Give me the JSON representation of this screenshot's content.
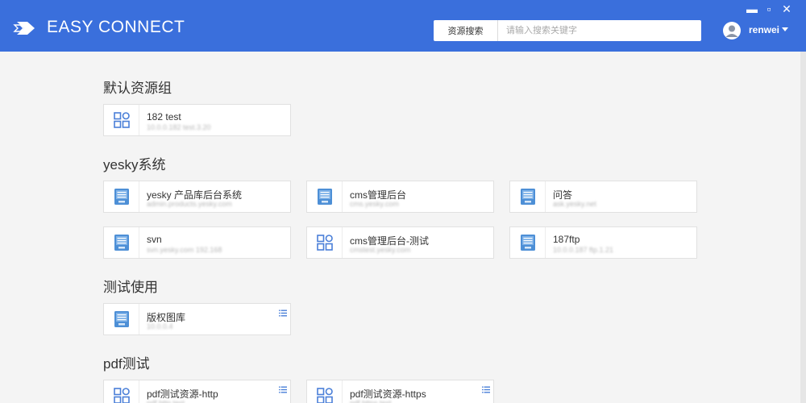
{
  "app": {
    "brand": "EASY CONNECT"
  },
  "search": {
    "button": "资源搜索",
    "placeholder": "请输入搜索关键字"
  },
  "user": {
    "name": "renwei"
  },
  "window": {
    "minimize": "▬",
    "maximize": "▫",
    "close": "✕"
  },
  "groups": [
    {
      "title": "默认资源组",
      "items": [
        {
          "name": "182 test",
          "sub": "10.0.0.182 test.3.20",
          "icon": "apps-grid-icon",
          "menu": false
        }
      ]
    },
    {
      "title": "yesky系统",
      "items": [
        {
          "name": "yesky 产品库后台系统",
          "sub": "admin.products.yesky.com",
          "icon": "document-icon",
          "menu": false
        },
        {
          "name": "cms管理后台",
          "sub": "cms.yesky.com",
          "icon": "document-icon",
          "menu": false
        },
        {
          "name": "问答",
          "sub": "ask.yesky.net",
          "icon": "document-icon",
          "menu": false
        },
        {
          "name": "svn",
          "sub": "svn.yesky.com 192.168",
          "icon": "document-icon",
          "menu": false
        },
        {
          "name": "cms管理后台-测试",
          "sub": "cmstest.yesky.com",
          "icon": "apps-grid-icon",
          "menu": false
        },
        {
          "name": "187ftp",
          "sub": "10.0.0.187 ftp.1.21",
          "icon": "document-icon",
          "menu": false
        }
      ]
    },
    {
      "title": "测试使用",
      "items": [
        {
          "name": "版权图库",
          "sub": "10.0.0.4",
          "icon": "document-icon",
          "menu": true
        }
      ]
    },
    {
      "title": "pdf测试",
      "items": [
        {
          "name": "pdf测试资源-http",
          "sub": "pdf.http.test",
          "icon": "apps-grid-icon",
          "menu": true
        },
        {
          "name": "pdf测试资源-https",
          "sub": "pdf.https.test",
          "icon": "apps-grid-icon",
          "menu": true
        }
      ]
    }
  ]
}
